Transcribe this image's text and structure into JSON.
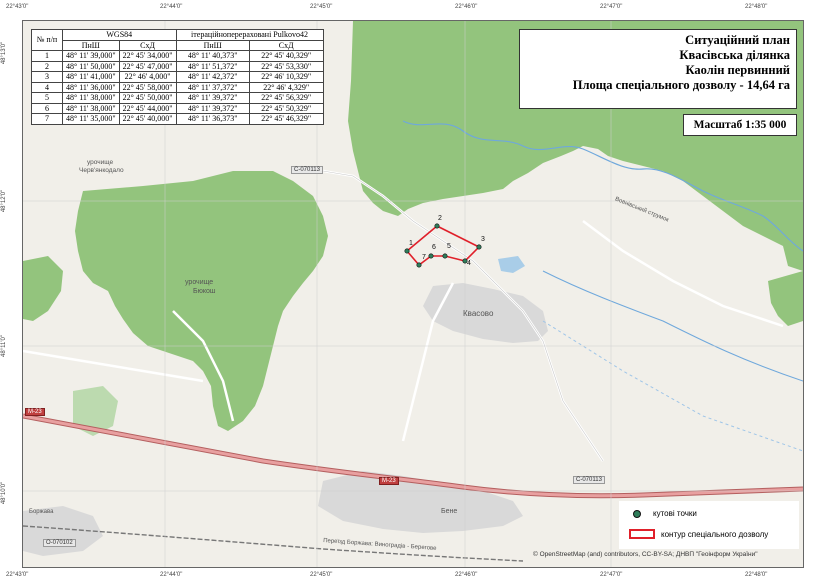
{
  "graticule": {
    "top": [
      "22°43'0\"",
      "22°44'0\"",
      "22°45'0\"",
      "22°46'0\"",
      "22°47'0\"",
      "22°48'0\""
    ],
    "bottom": [
      "22°43'0\"",
      "22°44'0\"",
      "22°45'0\"",
      "22°46'0\"",
      "22°47'0\"",
      "22°48'0\""
    ],
    "left": [
      "48°13'0\"",
      "48°12'0\"",
      "48°11'0\"",
      "48°10'0\""
    ],
    "right": [
      "48°13'0\"",
      "48°12'0\"",
      "48°11'0\"",
      "48°10'0\""
    ]
  },
  "coord_table": {
    "header_num": "№ п/п",
    "group_a": "WGS84",
    "group_b": "ітераційноперераховані Pulkovo42",
    "col_lat": "ПнШ",
    "col_lon": "СхД",
    "rows": [
      {
        "n": "1",
        "a_lat": "48° 11' 39,000\"",
        "a_lon": "22° 45' 34,000\"",
        "b_lat": "48° 11' 40,373\"",
        "b_lon": "22° 45' 40,329\""
      },
      {
        "n": "2",
        "a_lat": "48° 11' 50,000\"",
        "a_lon": "22° 45' 47,000\"",
        "b_lat": "48° 11' 51,372\"",
        "b_lon": "22° 45' 53,330\""
      },
      {
        "n": "3",
        "a_lat": "48° 11' 41,000\"",
        "a_lon": "22° 46' 4,000\"",
        "b_lat": "48° 11' 42,372\"",
        "b_lon": "22° 46' 10,329\""
      },
      {
        "n": "4",
        "a_lat": "48° 11' 36,000\"",
        "a_lon": "22° 45' 58,000\"",
        "b_lat": "48° 11' 37,372\"",
        "b_lon": "22° 46' 4,329\""
      },
      {
        "n": "5",
        "a_lat": "48° 11' 38,000\"",
        "a_lon": "22° 45' 50,000\"",
        "b_lat": "48° 11' 39,372\"",
        "b_lon": "22° 45' 56,329\""
      },
      {
        "n": "6",
        "a_lat": "48° 11' 38,000\"",
        "a_lon": "22° 45' 44,000\"",
        "b_lat": "48° 11' 39,372\"",
        "b_lon": "22° 45' 50,329\""
      },
      {
        "n": "7",
        "a_lat": "48° 11' 35,000\"",
        "a_lon": "22° 45' 40,000\"",
        "b_lat": "48° 11' 36,373\"",
        "b_lon": "22° 45' 46,329\""
      }
    ]
  },
  "title_box": {
    "line1": "Ситуаційний план",
    "line2": "Квасівська ділянка",
    "line3": "Каолін первинний",
    "line4": "Площа спеціального дозволу - 14,64 га"
  },
  "scale": "Масштаб 1:35 000",
  "legend": {
    "points_label": "кутові точки",
    "contour_label": "контур спеціального дозволу"
  },
  "attribution": "© OpenStreetMap (and) contributors, CC-BY-SA; ДНВП \"Геоінформ України\"",
  "places": {
    "kvasovo": "Квасово",
    "bukosh_1": "урочище",
    "bukosh_2": "Бюкош",
    "lankodalo_1": "урочище",
    "lankodalo_2": "Черв'янкодало",
    "beche": "Бене",
    "borzhava": "Боржава",
    "stream": "Вовнівський струмок",
    "perehon": "Переїзд Боржава: Виноградів - Берегове"
  },
  "roads": {
    "c070113_a": "С-070113",
    "c070113_b": "С-070113",
    "m23_a": "М-23",
    "m23_b": "М-23",
    "o070102": "О-070102"
  },
  "points": [
    "1",
    "2",
    "3",
    "4",
    "5",
    "6",
    "7"
  ],
  "colors": {
    "forest": "#93c47d",
    "land": "#f1efe9",
    "contour": "#e0202a",
    "point": "#2e7d5a",
    "water": "#a9cde8",
    "road_main": "#e8a0a0"
  }
}
